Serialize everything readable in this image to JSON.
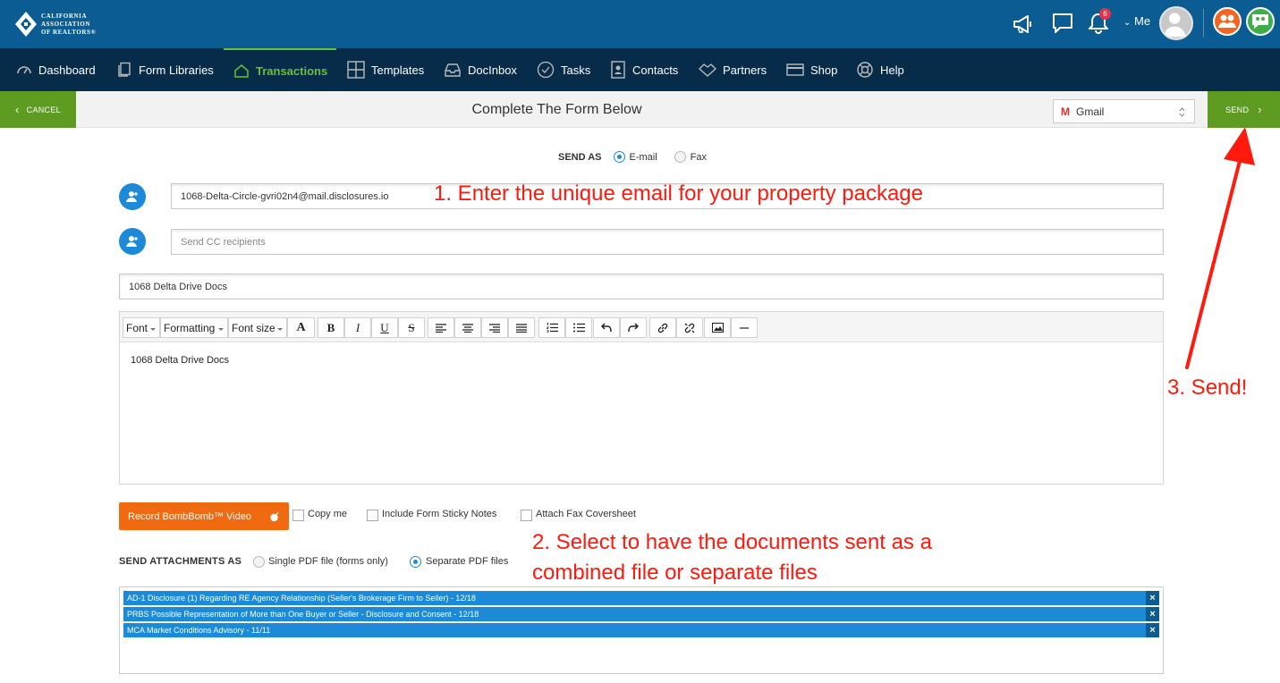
{
  "top_bar": {
    "logo_text": "CALIFORNIA\nASSOCIATION\nOF REALTORS®",
    "notification_count": "6",
    "me_label": "Me",
    "icons": [
      "megaphone-icon",
      "chat-icon",
      "bell-icon",
      "avatar",
      "orange-app-icon",
      "green-chat-app-icon"
    ]
  },
  "nav": {
    "items": [
      {
        "label": "Dashboard",
        "icon": "gauge-icon"
      },
      {
        "label": "Form Libraries",
        "icon": "pages-icon"
      },
      {
        "label": "Transactions",
        "icon": "house-icon",
        "active": true
      },
      {
        "label": "Templates",
        "icon": "grid-icon"
      },
      {
        "label": "DocInbox",
        "icon": "inbox-icon"
      },
      {
        "label": "Tasks",
        "icon": "check-circle-icon"
      },
      {
        "label": "Contacts",
        "icon": "contact-card-icon"
      },
      {
        "label": "Partners",
        "icon": "handshake-icon"
      },
      {
        "label": "Shop",
        "icon": "card-icon"
      },
      {
        "label": "Help",
        "icon": "lifebuoy-icon"
      }
    ]
  },
  "action_bar": {
    "cancel": "CANCEL",
    "title": "Complete The Form Below",
    "mail_provider": "Gmail",
    "send": "SEND"
  },
  "send_as": {
    "label": "SEND AS",
    "options": [
      {
        "label": "E-mail",
        "selected": true
      },
      {
        "label": "Fax",
        "selected": false
      }
    ]
  },
  "form": {
    "to_value": "1068-Delta-Circle-gvri02n4@mail.disclosures.io",
    "cc_placeholder": "Send CC recipients",
    "subject_value": "1068 Delta Drive Docs",
    "body_text": "1068 Delta Drive Docs"
  },
  "toolbar": {
    "font": "Font",
    "formatting": "Formatting",
    "font_size": "Font size",
    "buttons": [
      "text-color-icon",
      "bold-icon",
      "italic-icon",
      "underline-icon",
      "strikethrough-icon",
      "align-left-icon",
      "align-center-icon",
      "align-right-icon",
      "justify-icon",
      "ordered-list-icon",
      "unordered-list-icon",
      "undo-icon",
      "redo-icon",
      "link-icon",
      "unlink-icon",
      "image-icon",
      "horizontal-rule-icon"
    ]
  },
  "options": {
    "bombbomb": "Record BombBomb™ Video",
    "copy_me": "Copy me",
    "sticky_notes": "Include Form Sticky Notes",
    "fax_cover": "Attach Fax Coversheet"
  },
  "attachments": {
    "label": "SEND ATTACHMENTS AS",
    "single": "Single PDF file (forms only)",
    "separate": "Separate PDF files",
    "selected": "separate",
    "files": [
      "AD-1 Disclosure (1) Regarding RE Agency Relationship (Seller's Brokerage Firm to Seller) - 12/18",
      "PRBS Possible Representation of More than One Buyer or Seller - Disclosure and Consent - 12/18",
      "MCA Market Conditions Advisory - 11/11"
    ]
  },
  "annotations": {
    "step1": "1. Enter the unique email for your property package",
    "step2_line1": "2. Select to have the documents sent as a",
    "step2_line2": "combined file or separate files",
    "step3": "3. Send!",
    "color": "#ff1a0d"
  },
  "colors": {
    "top_bar": "#0b5c92",
    "nav_bar": "#072c4a",
    "accent_green": "#5e9b21",
    "active_nav": "#6bbf3b",
    "blue": "#1c8ad6",
    "orange": "#f26a0f"
  }
}
